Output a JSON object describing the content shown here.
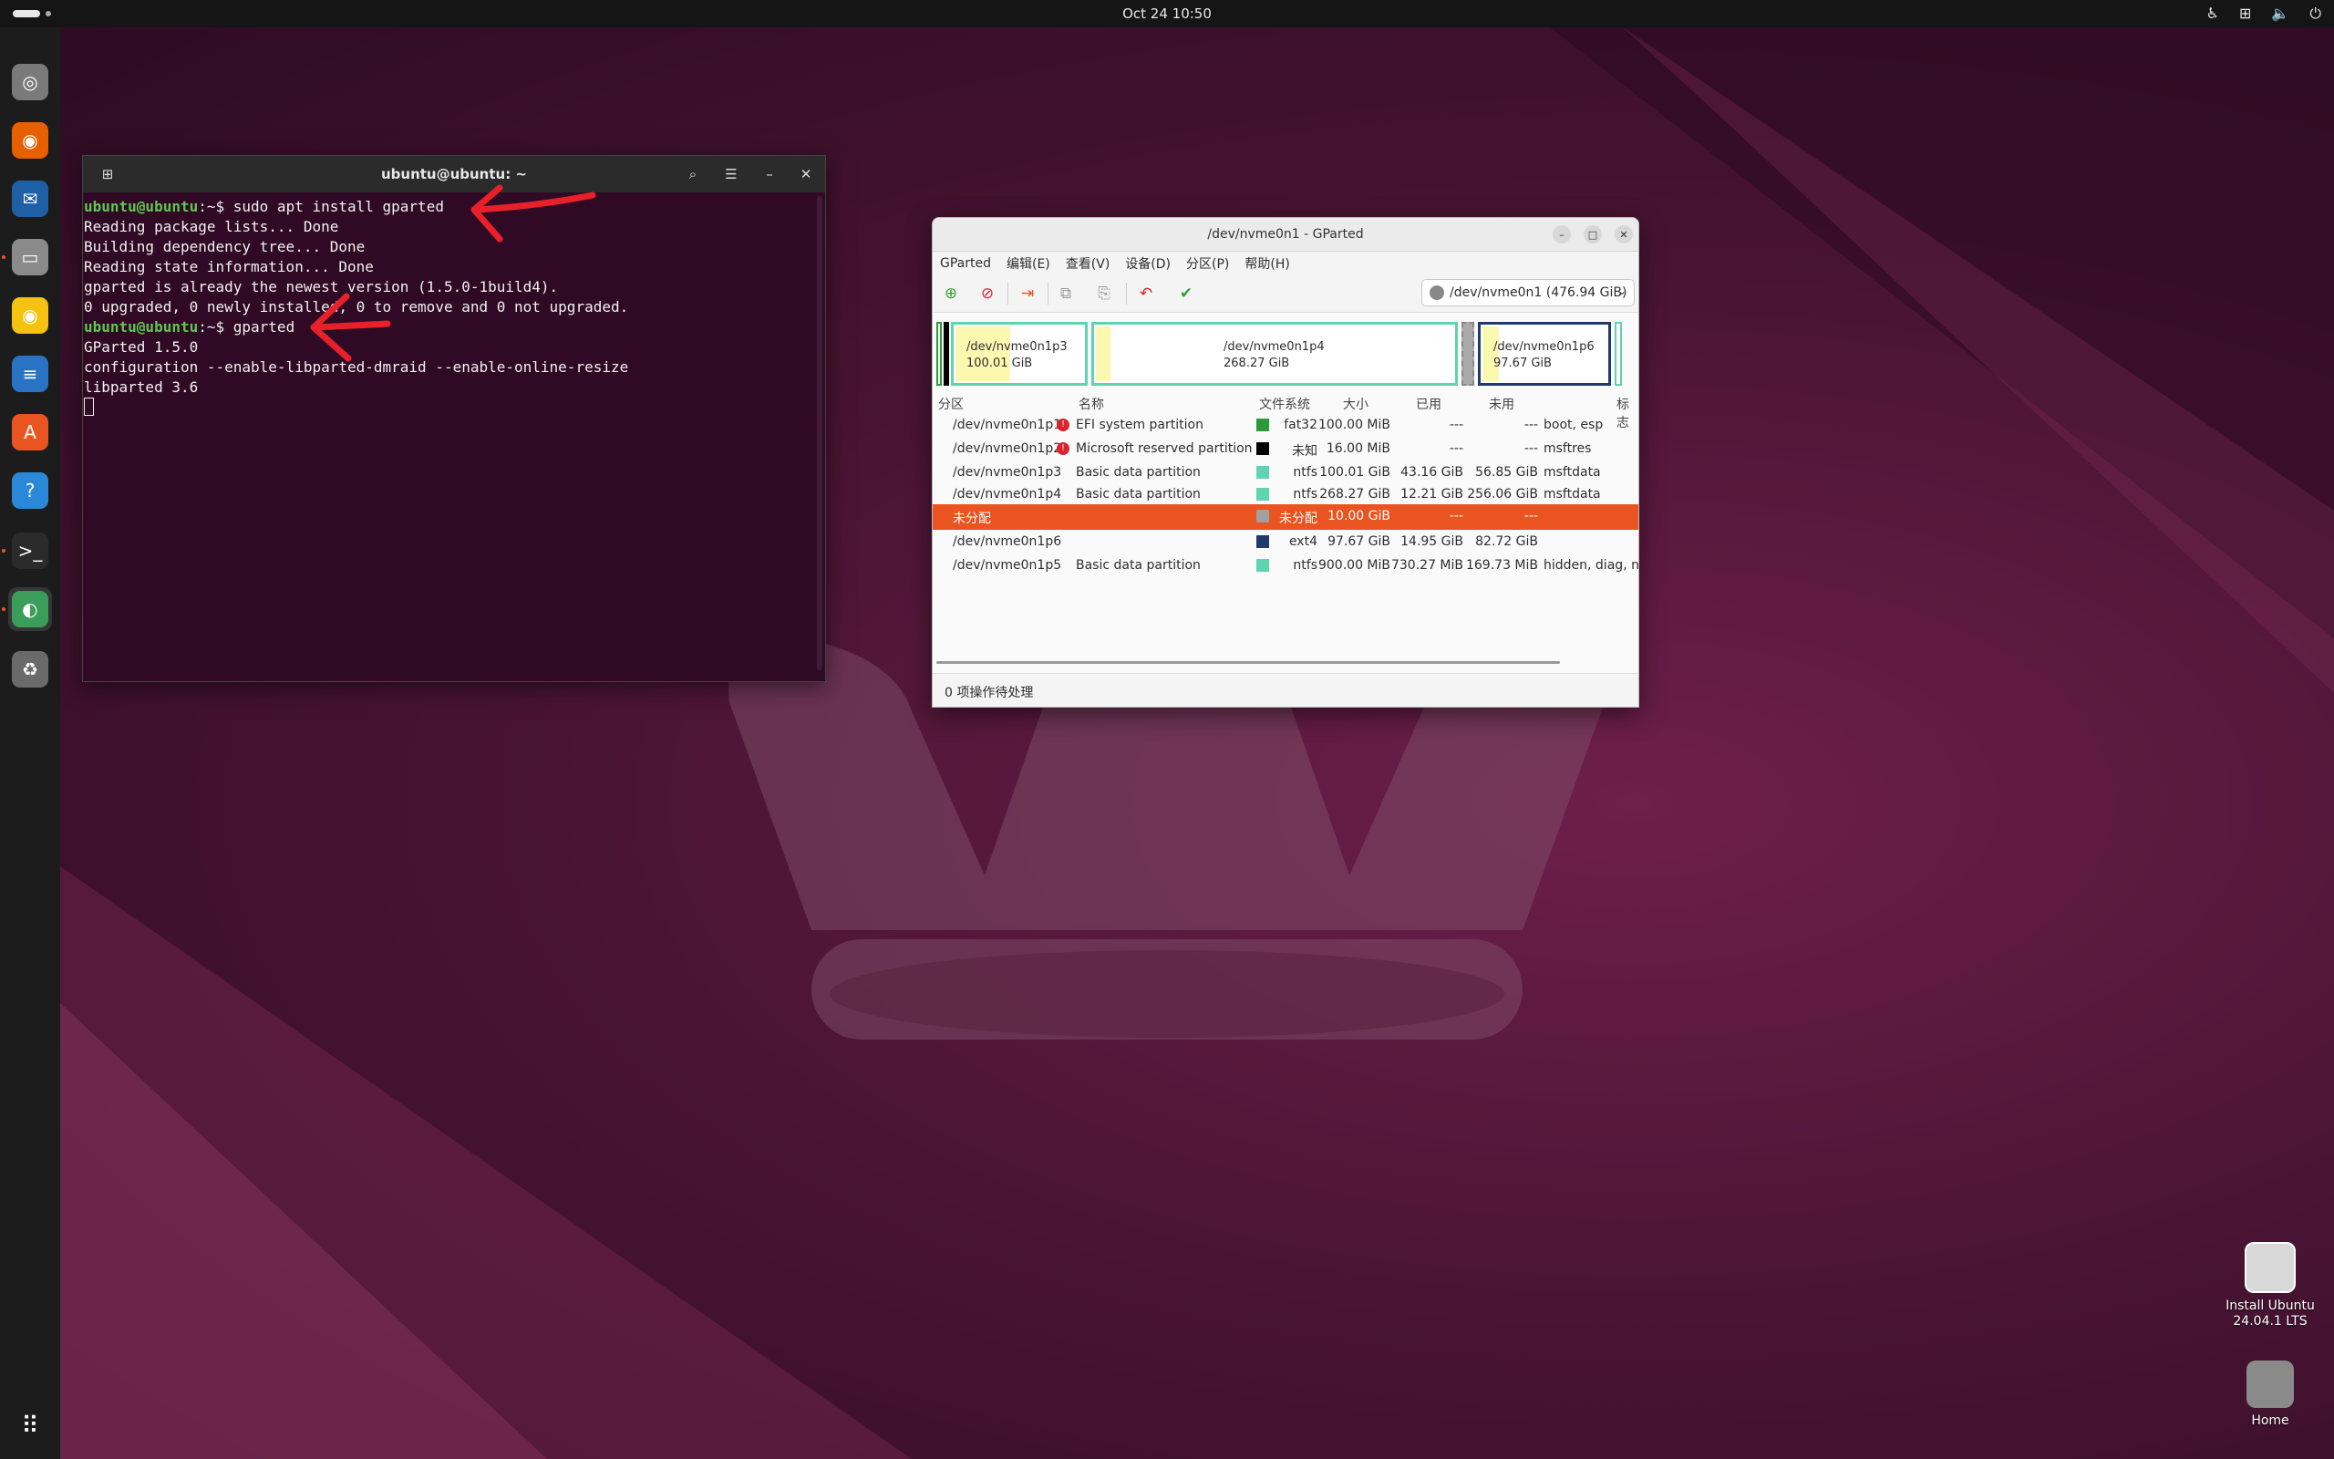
{
  "topbar": {
    "clock": "Oct 24  10:50"
  },
  "dock": {
    "items": [
      {
        "name": "install-ubuntu",
        "glyph": "◎",
        "color": "#7a7a7a"
      },
      {
        "name": "firefox",
        "glyph": "◉",
        "color": "#e66000"
      },
      {
        "name": "thunderbird",
        "glyph": "✉",
        "color": "#1f5fa6"
      },
      {
        "name": "files",
        "glyph": "▭",
        "color": "#8a8a8a"
      },
      {
        "name": "rhythmbox",
        "glyph": "◉",
        "color": "#f5c211"
      },
      {
        "name": "libreoffice-writer",
        "glyph": "≡",
        "color": "#2a72c4"
      },
      {
        "name": "app-center",
        "glyph": "A",
        "color": "#e95420"
      },
      {
        "name": "help",
        "glyph": "?",
        "color": "#2b88d8"
      },
      {
        "name": "terminal",
        "glyph": ">_",
        "color": "#2b2b2b"
      },
      {
        "name": "gparted",
        "glyph": "◐",
        "color": "#3a9e5a"
      },
      {
        "name": "trash",
        "glyph": "♻",
        "color": "#6a6a6a"
      }
    ],
    "show_apps_glyph": "⠿"
  },
  "terminal": {
    "title": "ubuntu@ubuntu: ~",
    "prompt_user": "ubuntu@ubuntu",
    "prompt_sep": ":~$ ",
    "cmd1": "sudo apt install gparted",
    "out1": "Reading package lists... Done",
    "out2": "Building dependency tree... Done",
    "out3": "Reading state information... Done",
    "out4": "gparted is already the newest version (1.5.0-1build4).",
    "out5": "0 upgraded, 0 newly installed, 0 to remove and 0 not upgraded.",
    "cmd2": "gparted",
    "out6": "GParted 1.5.0",
    "out7": "configuration --enable-libparted-dmraid --enable-online-resize",
    "out8": "libparted 3.6"
  },
  "gparted": {
    "title": "/dev/nvme0n1 - GParted",
    "menu": [
      "GParted",
      "编辑(E)",
      "查看(V)",
      "设备(D)",
      "分区(P)",
      "帮助(H)"
    ],
    "device": "/dev/nvme0n1 (476.94 GiB)",
    "map": {
      "p3_name": "/dev/nvme0n1p3",
      "p3_size": "100.01 GiB",
      "p4_name": "/dev/nvme0n1p4",
      "p4_size": "268.27 GiB",
      "p6_name": "/dev/nvme0n1p6",
      "p6_size": "97.67 GiB"
    },
    "columns": [
      "分区",
      "名称",
      "文件系统",
      "大小",
      "已用",
      "未用",
      "标志"
    ],
    "rows": [
      {
        "partition": "/dev/nvme0n1p1",
        "warn": true,
        "name": "EFI system partition",
        "color": "#2a9a3a",
        "fs": "fat32",
        "size": "100.00 MiB",
        "used": "---",
        "unused": "---",
        "flags": "boot, esp",
        "selected": false
      },
      {
        "partition": "/dev/nvme0n1p2",
        "warn": true,
        "name": "Microsoft reserved partition",
        "color": "#000000",
        "fs": "未知",
        "size": "16.00 MiB",
        "used": "---",
        "unused": "---",
        "flags": "msftres",
        "selected": false
      },
      {
        "partition": "/dev/nvme0n1p3",
        "warn": false,
        "name": "Basic data partition",
        "color": "#5fd4b0",
        "fs": "ntfs",
        "size": "100.01 GiB",
        "used": "43.16 GiB",
        "unused": "56.85 GiB",
        "flags": "msftdata",
        "selected": false
      },
      {
        "partition": "/dev/nvme0n1p4",
        "warn": false,
        "name": "Basic data partition",
        "color": "#5fd4b0",
        "fs": "ntfs",
        "size": "268.27 GiB",
        "used": "12.21 GiB",
        "unused": "256.06 GiB",
        "flags": "msftdata",
        "selected": false
      },
      {
        "partition": "未分配",
        "warn": false,
        "name": "",
        "color": "#a0a0a0",
        "fs": "未分配",
        "size": "10.00 GiB",
        "used": "---",
        "unused": "---",
        "flags": "",
        "selected": true
      },
      {
        "partition": "/dev/nvme0n1p6",
        "warn": false,
        "name": "",
        "color": "#1f3a6e",
        "fs": "ext4",
        "size": "97.67 GiB",
        "used": "14.95 GiB",
        "unused": "82.72 GiB",
        "flags": "",
        "selected": false
      },
      {
        "partition": "/dev/nvme0n1p5",
        "warn": false,
        "name": "Basic data partition",
        "color": "#5fd4b0",
        "fs": "ntfs",
        "size": "900.00 MiB",
        "used": "730.27 MiB",
        "unused": "169.73 MiB",
        "flags": "hidden, diag, no",
        "selected": false
      }
    ],
    "status": "0 项操作待处理"
  },
  "desktop": {
    "install_label_1": "Install Ubuntu",
    "install_label_2": "24.04.1 LTS",
    "home_label": "Home"
  }
}
